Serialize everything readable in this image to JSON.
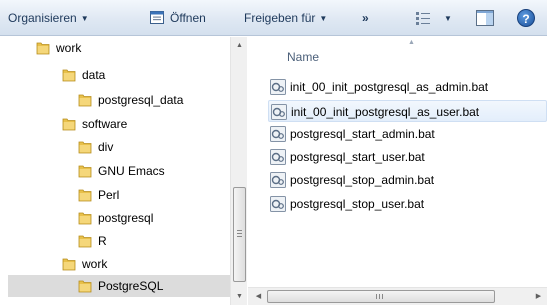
{
  "toolbar": {
    "organize_label": "Organisieren",
    "open_label": "Öffnen",
    "share_label": "Freigeben für",
    "more_label": "»",
    "help_label": "?"
  },
  "nav": {
    "items": [
      {
        "label": "work",
        "level": 0,
        "selected": false
      },
      {
        "label": "data",
        "level": 1,
        "selected": false
      },
      {
        "label": "postgresql_data",
        "level": 2,
        "selected": false
      },
      {
        "label": "software",
        "level": 1,
        "selected": false
      },
      {
        "label": "div",
        "level": 2,
        "selected": false
      },
      {
        "label": "GNU Emacs",
        "level": 2,
        "selected": false
      },
      {
        "label": "Perl",
        "level": 2,
        "selected": false
      },
      {
        "label": "postgresql",
        "level": 2,
        "selected": false
      },
      {
        "label": "R",
        "level": 2,
        "selected": false
      },
      {
        "label": "work",
        "level": 1,
        "selected": false
      },
      {
        "label": "PostgreSQL",
        "level": 2,
        "selected": true
      }
    ]
  },
  "files": {
    "column_name": "Name",
    "items": [
      {
        "name": "init_00_init_postgresql_as_admin.bat",
        "hover": false
      },
      {
        "name": "init_00_init_postgresql_as_user.bat",
        "hover": true
      },
      {
        "name": "postgresql_start_admin.bat",
        "hover": false
      },
      {
        "name": "postgresql_start_user.bat",
        "hover": false
      },
      {
        "name": "postgresql_stop_admin.bat",
        "hover": false
      },
      {
        "name": "postgresql_stop_user.bat",
        "hover": false
      }
    ]
  },
  "colors": {
    "toolbar_text": "#1e395b",
    "folder": "#e8c04a",
    "selected_row": "#dcdcdc",
    "hover_row": "#e3eefb"
  }
}
